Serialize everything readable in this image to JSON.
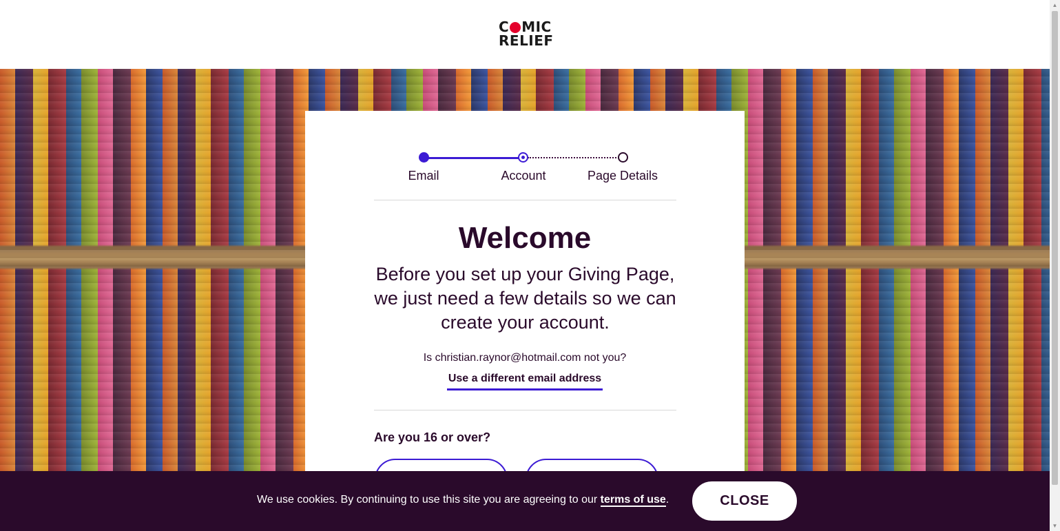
{
  "header": {
    "logo_line1_a": "C",
    "logo_line1_b": "MIC",
    "logo_line2": "RELIEF"
  },
  "stepper": {
    "steps": [
      {
        "label": "Email",
        "state": "done"
      },
      {
        "label": "Account",
        "state": "current"
      },
      {
        "label": "Page Details",
        "state": "todo"
      }
    ]
  },
  "main": {
    "title": "Welcome",
    "intro": "Before you set up your Giving Page, we just need a few details so we can create your account.",
    "not_you": "Is christian.raynor@hotmail.com not you?",
    "change_email_link": "Use a different email address",
    "age_question": "Are you 16 or over?",
    "answer_yes": "",
    "answer_no": ""
  },
  "cookie_banner": {
    "text": "We use cookies. By continuing to use this site you are agreeing to our ",
    "link": "terms of use",
    "text_end": ".",
    "close_label": "CLOSE"
  },
  "colors": {
    "accent": "#3c1bd4",
    "brand_dark": "#2a0a2b",
    "logo_red": "#e4002b"
  }
}
